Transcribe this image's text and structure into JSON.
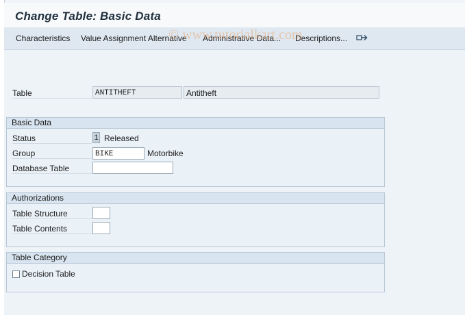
{
  "window": {
    "title": "Change Table: Basic Data"
  },
  "toolbar": {
    "items": [
      "Characteristics",
      "Value Assignment Alternative",
      "Administrative Data...",
      "Descriptions..."
    ],
    "more_icon": "export-arrow-icon"
  },
  "watermark": "© www.tutorialkart.com",
  "header": {
    "table_label": "Table",
    "table_value": "ANTITHEFT",
    "table_description": "Antitheft"
  },
  "basic_data": {
    "title": "Basic Data",
    "status_label": "Status",
    "status_value": "1",
    "status_text": "Released",
    "group_label": "Group",
    "group_value": "BIKE",
    "group_text": "Motorbike",
    "db_table_label": "Database Table",
    "db_table_value": ""
  },
  "authorizations": {
    "title": "Authorizations",
    "structure_label": "Table Structure",
    "structure_value": "",
    "contents_label": "Table Contents",
    "contents_value": ""
  },
  "table_category": {
    "title": "Table Category",
    "decision_table_label": "Decision Table",
    "decision_table_checked": false
  }
}
